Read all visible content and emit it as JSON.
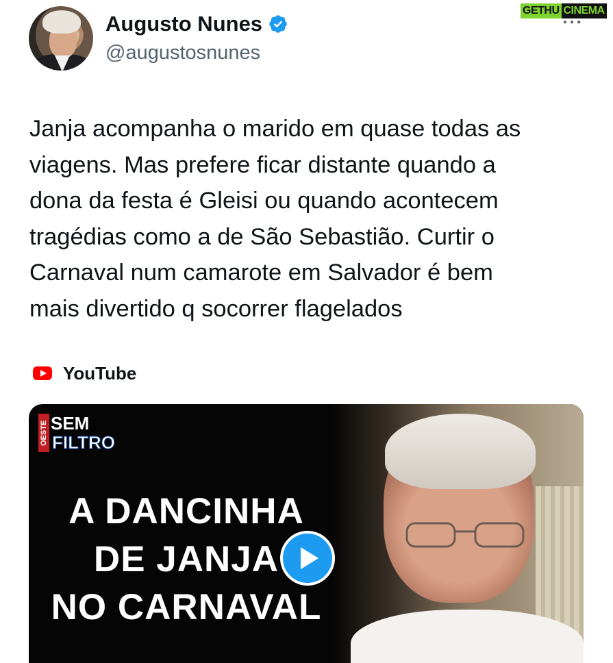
{
  "author": {
    "display_name": "Augusto Nunes",
    "handle": "@augustosnunes",
    "verified_icon": "verified-badge-icon"
  },
  "watermark": {
    "part_a": "GETHU",
    "part_b": "CINEMA",
    "dots": "●●●"
  },
  "tweet": {
    "lines": [
      "Janja acompanha o marido em quase todas as",
      "viagens. Mas prefere ficar distante quando a",
      "dona da festa é Gleisi ou quando acontecem",
      "tragédias como a de São Sebastião. Curtir o",
      "Carnaval num camarote em Salvador é bem",
      "mais divertido q socorrer flagelados"
    ]
  },
  "link_card": {
    "source": "YouTube",
    "source_icon": "youtube-icon",
    "thumbnail": {
      "brand": "OESTE",
      "badge_line1": "SEM",
      "badge_line2": "FILTRO",
      "headline": [
        "A DANCINHA",
        "DE JANJA",
        "NO CARNAVAL"
      ]
    },
    "play_icon": "play-icon",
    "accent": "#1d9bf0"
  },
  "colors": {
    "text": "#0f1419",
    "secondary": "#536471",
    "youtube_red": "#ff0000",
    "verified_blue": "#1d9bf0"
  }
}
